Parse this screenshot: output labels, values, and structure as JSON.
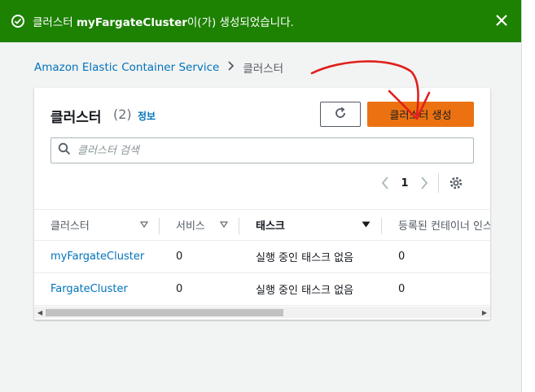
{
  "banner": {
    "message_prefix": "클러스터 ",
    "cluster_name": "myFargateCluster",
    "message_suffix": "이(가) 생성되었습니다.",
    "color": "#1d8102"
  },
  "breadcrumb": {
    "root": "Amazon Elastic Container Service",
    "current": "클러스터"
  },
  "panel": {
    "title": "클러스터",
    "count": "(2)",
    "info": "정보",
    "create_button": "클러스터 생성",
    "accent_color": "#ec7211",
    "search_placeholder": "클러스터 검색",
    "page_number": "1"
  },
  "table": {
    "columns": [
      "클러스터",
      "서비스",
      "태스크",
      "등록된 컨테이너 인스턴스"
    ],
    "rows": [
      {
        "cluster": "myFargateCluster",
        "services": "0",
        "tasks": "실행 중인 태스크 없음",
        "instances": "0"
      },
      {
        "cluster": "FargateCluster",
        "services": "0",
        "tasks": "실행 중인 태스크 없음",
        "instances": "0"
      }
    ]
  },
  "icons": {
    "banner_status": "check-circle-icon",
    "banner_close": "close-icon",
    "refresh": "refresh-icon",
    "search": "search-icon",
    "prev": "chevron-left-icon",
    "next": "chevron-right-icon",
    "settings": "gear-icon"
  }
}
